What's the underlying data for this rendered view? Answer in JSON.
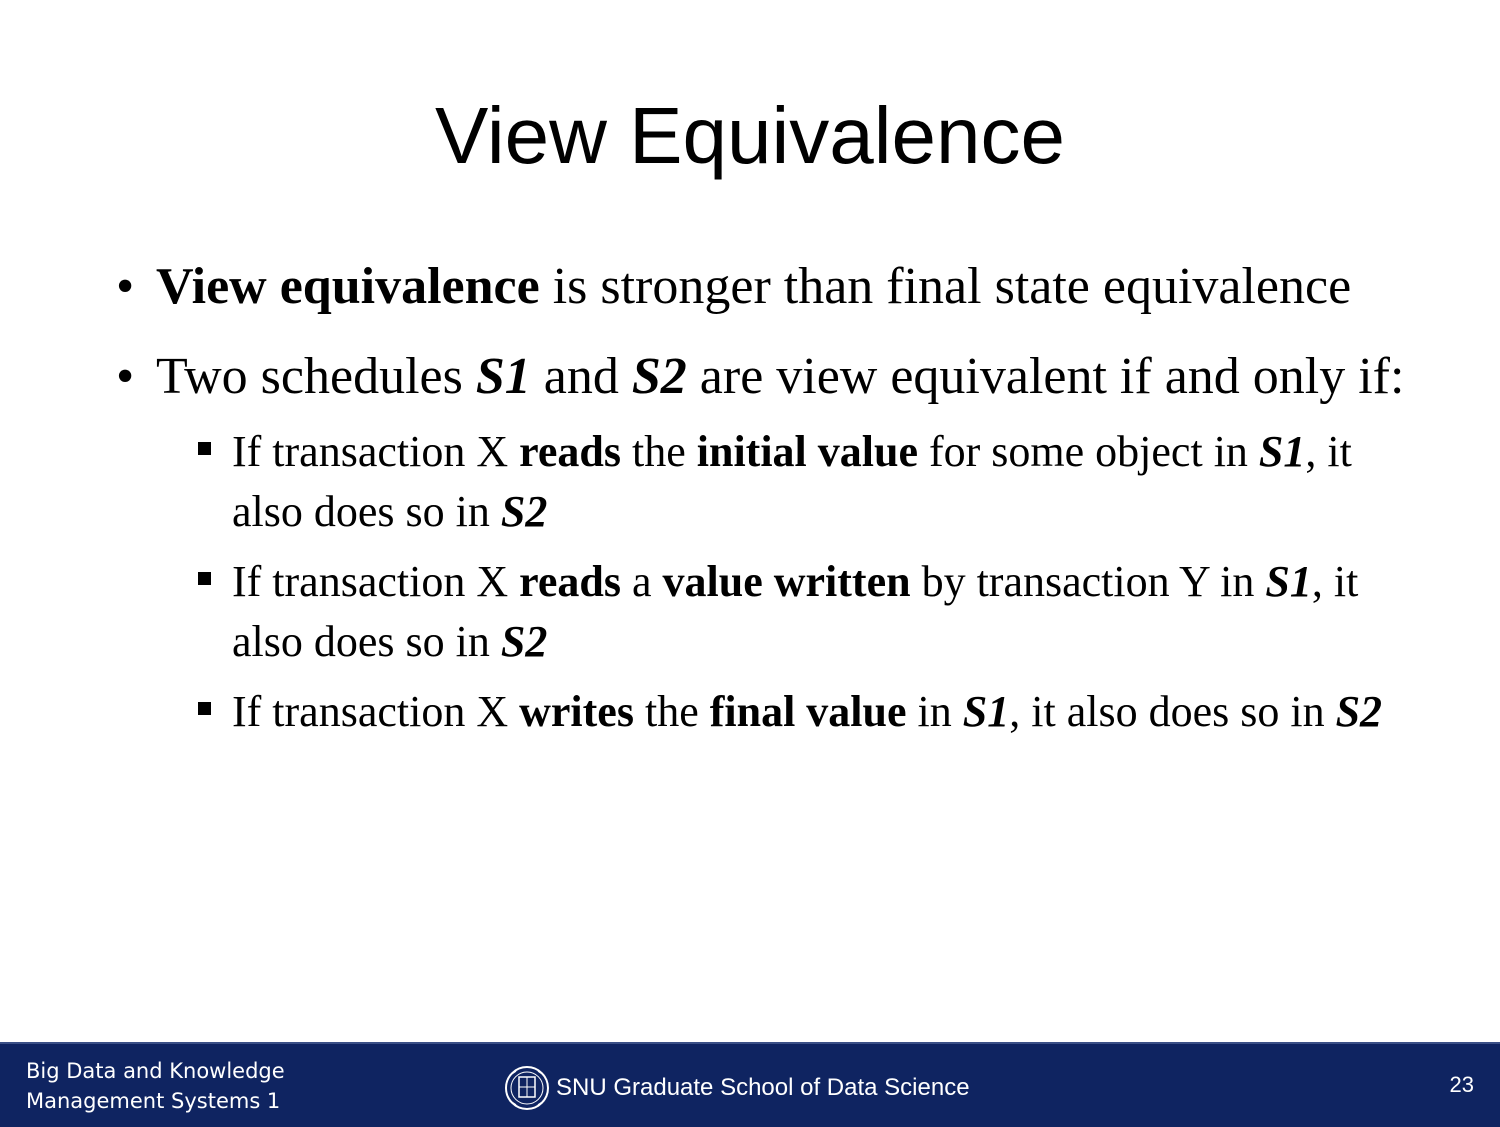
{
  "slide": {
    "title": "View Equivalence",
    "bullets": [
      {
        "bold": "View equivalence",
        "text": " is stronger than final state equivalence"
      },
      {
        "t1": "Two schedules ",
        "s1": "S1",
        "t2": " and ",
        "s2": "S2",
        "t3": " are view equivalent if and only if:"
      }
    ],
    "subbullets": [
      {
        "a": "If transaction X ",
        "b": "reads",
        "c": " the ",
        "d": "initial value",
        "e": " for some object in ",
        "f": "S1",
        "g": ", it also does so in ",
        "h": "S2"
      },
      {
        "a": "If transaction X ",
        "b": "reads",
        "c": " a ",
        "d": "value written",
        "e": " by transaction Y in ",
        "f": "S1",
        "g": ", it also does so in ",
        "h": "S2"
      },
      {
        "a": "If transaction X ",
        "b": "writes",
        "c": " the ",
        "d": "final value",
        "e": " in ",
        "f": "S1",
        "g": ", it also does so in ",
        "h": "S2"
      }
    ]
  },
  "footer": {
    "course_line1": "Big Data and Knowledge",
    "course_line2": "Management Systems 1",
    "school": "SNU Graduate School of Data Science",
    "page_number": "23",
    "logo_icon": "snu-emblem-icon",
    "background": "#0f2461"
  }
}
